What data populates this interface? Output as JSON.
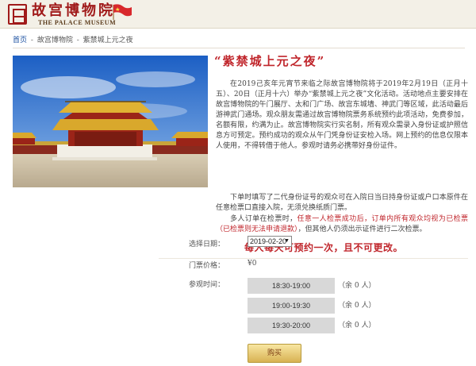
{
  "header": {
    "logo_text": "故宫博物院",
    "logo_subtitle": "THE PALACE MUSEUM"
  },
  "breadcrumb": {
    "items": [
      "首页",
      "故宫博物院",
      "紫禁城上元之夜"
    ],
    "separator": "-"
  },
  "photo": {
    "alt": "故宫太和殿"
  },
  "article": {
    "title": "“紫禁城上元之夜”",
    "paragraph1": "在2019己亥年元宵节来临之际故宫博物院将于2019年2月19日（正月十五）、20日（正月十六）举办“紫禁城上元之夜”文化活动。活动地点主要安排在故宫博物院的午门展厅、太和门广场、故宫东城墙、神武门等区域，此活动最后游神武门通场。观众朋友需通过故宫博物院票务系统预约此项活动，免费参加，名额有限，约满为止。故宫博物院实行实名制，所有观众需录入身份证或护照信息方可预定。预约成功的观众从午门凭身份证安检入场。网上预约的信息仅限本人使用，不得转借于他人。参观时请务必携带好身份证件。",
    "paragraph2": "下单时填写了二代身份证号的观众可在入院日当日持身份证或户口本原件在任意检票口直接入院，无须兑换纸质门票。",
    "paragraph3_prefix": "多人订单在检票时，",
    "paragraph3_red": "任意一人检票成功后，订单内所有观众均视为已检票（已检票则无法申请退款）",
    "paragraph3_suffix": "，但其他人仍须出示证件进行二次检票。",
    "notice": "每人每天可预约一次，且不可更改。"
  },
  "booking": {
    "date_label": "选择日期：",
    "date_value": "2019-02-20",
    "price_label": "门票价格：",
    "price_value": "¥0",
    "time_label": "参观时间：",
    "slots": [
      {
        "time": "18:30-19:00",
        "remaining": "（余 0 人）"
      },
      {
        "time": "19:00-19:30",
        "remaining": "（余 0 人）"
      },
      {
        "time": "19:30-20:00",
        "remaining": "（余 0 人）"
      }
    ],
    "buy_label": "购买"
  },
  "colors": {
    "accent_red": "#c0262c",
    "link_blue": "#1a4fa0",
    "button_gold": "#d8b253"
  }
}
